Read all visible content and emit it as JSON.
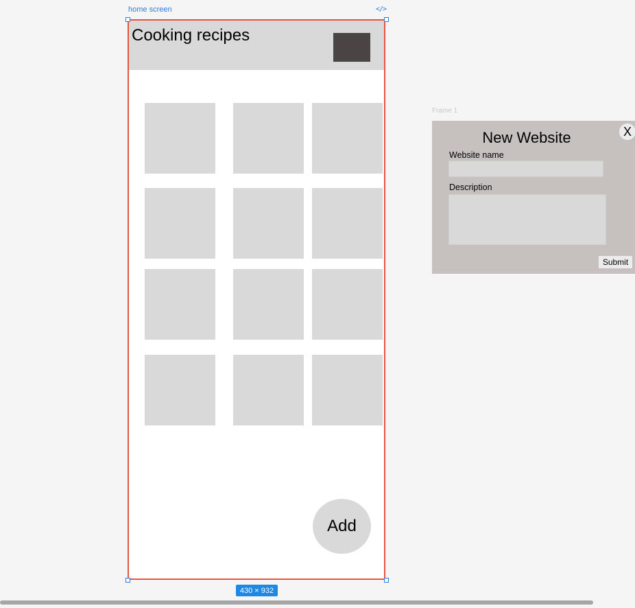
{
  "canvas": {
    "home_frame_label": "home screen",
    "code_icon": "</>",
    "size_badge": "430 × 932",
    "modal_frame_label": "Frame 1"
  },
  "home": {
    "title": "Cooking recipes",
    "tile_count": 12,
    "add_label": "Add"
  },
  "modal": {
    "title": "New Website",
    "close_label": "X",
    "name_label": "Website name",
    "name_value": "",
    "description_label": "Description",
    "description_value": "",
    "submit_label": "Submit"
  },
  "colors": {
    "frame_border": "#e8553f",
    "selection": "#2d7be5",
    "placeholder": "#d9d9d9",
    "modal_bg": "#c6c1bf",
    "header_thumb": "#4a4444"
  }
}
